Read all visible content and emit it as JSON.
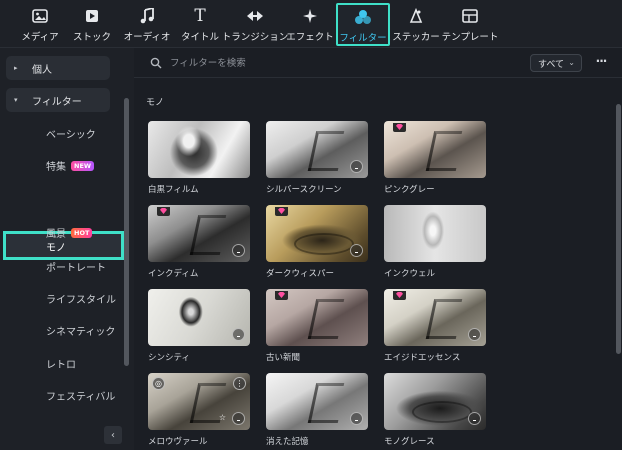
{
  "toolbar": {
    "items": [
      {
        "label": "メディア",
        "icon": "media-icon"
      },
      {
        "label": "ストック",
        "icon": "stock-media-icon"
      },
      {
        "label": "オーディオ",
        "icon": "music-note-icon"
      },
      {
        "label": "タイトル",
        "icon": "title-text-icon"
      },
      {
        "label": "トランジション",
        "icon": "transition-icon"
      },
      {
        "label": "エフェクト",
        "icon": "effects-sparkle-icon"
      },
      {
        "label": "フィルター",
        "icon": "filter-circles-icon",
        "active": true
      },
      {
        "label": "ステッカー",
        "icon": "sticker-icon"
      },
      {
        "label": "テンプレート",
        "icon": "template-icon"
      }
    ],
    "active_color": "#3fc7f0",
    "highlight_color": "#3fe0c8"
  },
  "sidebar": {
    "group_personal": "個人",
    "group_filters": "フィルター",
    "items": [
      {
        "label": "ベーシック"
      },
      {
        "label": "特集",
        "badge": "NEW"
      },
      {
        "label": "モノ",
        "selected": true
      },
      {
        "label": "風景",
        "badge": "HOT"
      },
      {
        "label": "ポートレート"
      },
      {
        "label": "ライフスタイル"
      },
      {
        "label": "シネマティック"
      },
      {
        "label": "レトロ"
      },
      {
        "label": "フェスティバル"
      }
    ],
    "collapse_icon": "chevron-left-icon"
  },
  "search": {
    "placeholder": "フィルターを検索",
    "filter_value": "すべて",
    "more_icon": "more-horizontal-icon"
  },
  "section": {
    "title": "モノ"
  },
  "filters": [
    {
      "name": "白黒フィルム"
    },
    {
      "name": "シルバースクリーン",
      "download": true
    },
    {
      "name": "ピンクグレー",
      "premium": true
    },
    {
      "name": "インクディム",
      "premium": true,
      "download": true
    },
    {
      "name": "ダークウィスパー",
      "premium": true,
      "download": true
    },
    {
      "name": "インクウェル"
    },
    {
      "name": "シンシティ",
      "download": true
    },
    {
      "name": "古い新聞",
      "premium": true
    },
    {
      "name": "エイジドエッセンス",
      "premium": true,
      "download": true
    },
    {
      "name": "メロウヴァール",
      "download": true
    },
    {
      "name": "消えた記憶",
      "download": true
    },
    {
      "name": "モノグレース",
      "download": true
    }
  ]
}
